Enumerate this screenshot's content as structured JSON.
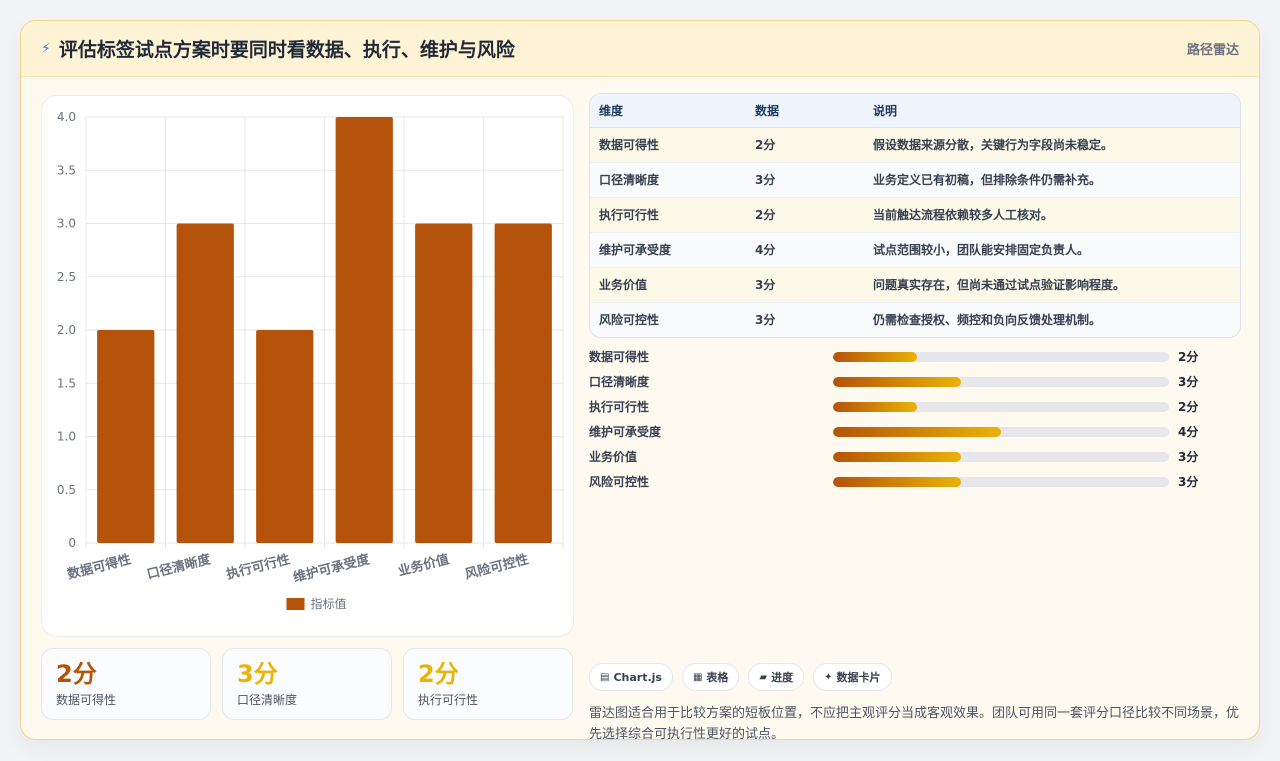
{
  "header": {
    "title": "评估标签试点方案时要同时看数据、执行、维护与风险",
    "tag": "路径雷达"
  },
  "chart_data": {
    "type": "bar",
    "categories": [
      "数据可得性",
      "口径清晰度",
      "执行可行性",
      "维护可承受度",
      "业务价值",
      "风险可控性"
    ],
    "series": [
      {
        "name": "指标值",
        "values": [
          2,
          3,
          2,
          4,
          3,
          3
        ]
      }
    ],
    "ylim": [
      0,
      4
    ],
    "yticks": [
      "0",
      "0.5",
      "1.0",
      "1.5",
      "2.0",
      "2.5",
      "3.0",
      "3.5",
      "4.0"
    ],
    "grid": true,
    "legend": "bottom",
    "color": "#b45309"
  },
  "kpis": [
    {
      "value": "2分",
      "label": "数据可得性",
      "color": "#b45309"
    },
    {
      "value": "3分",
      "label": "口径清晰度",
      "color": "#eab308"
    },
    {
      "value": "2分",
      "label": "执行可行性",
      "color": "#eab308"
    }
  ],
  "table": {
    "headers": [
      "维度",
      "数据",
      "说明"
    ],
    "rows": [
      [
        "数据可得性",
        "2分",
        "假设数据来源分散，关键行为字段尚未稳定。"
      ],
      [
        "口径清晰度",
        "3分",
        "业务定义已有初稿，但排除条件仍需补充。"
      ],
      [
        "执行可行性",
        "2分",
        "当前触达流程依赖较多人工核对。"
      ],
      [
        "维护可承受度",
        "4分",
        "试点范围较小，团队能安排固定负责人。"
      ],
      [
        "业务价值",
        "3分",
        "问题真实存在，但尚未通过试点验证影响程度。"
      ],
      [
        "风险可控性",
        "3分",
        "仍需检查授权、频控和负向反馈处理机制。"
      ]
    ]
  },
  "progress": [
    {
      "label": "数据可得性",
      "value": "2分",
      "fraction": 0.25
    },
    {
      "label": "口径清晰度",
      "value": "3分",
      "fraction": 0.38
    },
    {
      "label": "执行可行性",
      "value": "2分",
      "fraction": 0.25
    },
    {
      "label": "维护可承受度",
      "value": "4分",
      "fraction": 0.5
    },
    {
      "label": "业务价值",
      "value": "3分",
      "fraction": 0.38
    },
    {
      "label": "风险可控性",
      "value": "3分",
      "fraction": 0.38
    }
  ],
  "chips": [
    {
      "icon": "chart-icon",
      "glyph": "▤",
      "label": "Chart.js"
    },
    {
      "icon": "table-icon",
      "glyph": "▦",
      "label": "表格"
    },
    {
      "icon": "progress-icon",
      "glyph": "▰",
      "label": "进度"
    },
    {
      "icon": "sparkle-icon",
      "glyph": "✦",
      "label": "数据卡片"
    }
  ],
  "note": "雷达图适合用于比较方案的短板位置，不应把主观评分当成客观效果。团队可用同一套评分口径比较不同场景，优先选择综合可执行性更好的试点。"
}
